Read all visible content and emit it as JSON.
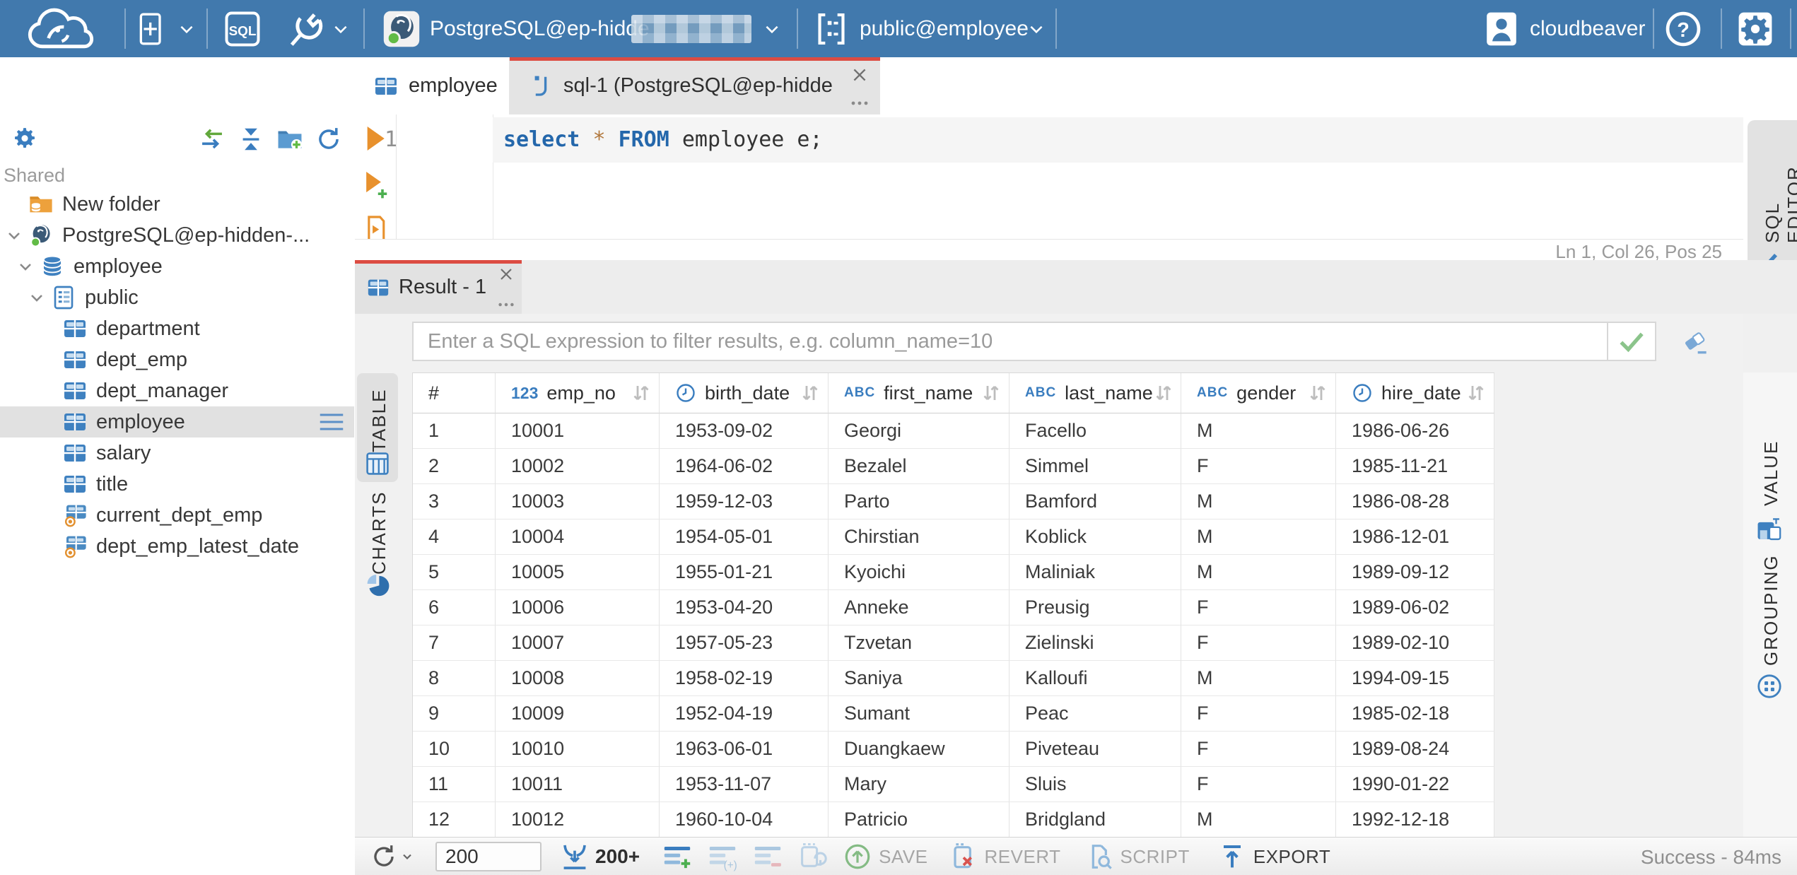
{
  "topbar": {
    "connection_label": "PostgreSQL@ep-hidde",
    "connection_redacted": true,
    "schema_label": "public@employee",
    "user_label": "cloudbeaver",
    "bg_color": "#4179ad"
  },
  "sidebar": {
    "section_label": "Shared",
    "items": [
      {
        "label": "New folder",
        "icon": "folder-db",
        "depth": 0,
        "expanded": false,
        "selected": false
      },
      {
        "label": "PostgreSQL@ep-hidden-...",
        "icon": "postgres",
        "depth": 0,
        "expanded": true,
        "selected": false
      },
      {
        "label": "employee",
        "icon": "database",
        "depth": 1,
        "expanded": true,
        "selected": false
      },
      {
        "label": "public",
        "icon": "schema",
        "depth": 2,
        "expanded": true,
        "selected": false
      },
      {
        "label": "department",
        "icon": "table",
        "depth": 3,
        "expanded": false,
        "selected": false
      },
      {
        "label": "dept_emp",
        "icon": "table",
        "depth": 3,
        "expanded": false,
        "selected": false
      },
      {
        "label": "dept_manager",
        "icon": "table",
        "depth": 3,
        "expanded": false,
        "selected": false
      },
      {
        "label": "employee",
        "icon": "table",
        "depth": 3,
        "expanded": false,
        "selected": true
      },
      {
        "label": "salary",
        "icon": "table",
        "depth": 3,
        "expanded": false,
        "selected": false
      },
      {
        "label": "title",
        "icon": "table",
        "depth": 3,
        "expanded": false,
        "selected": false
      },
      {
        "label": "current_dept_emp",
        "icon": "view",
        "depth": 3,
        "expanded": false,
        "selected": false
      },
      {
        "label": "dept_emp_latest_date",
        "icon": "view",
        "depth": 3,
        "expanded": false,
        "selected": false
      }
    ]
  },
  "tabs": {
    "items": [
      {
        "label": "employee",
        "active": false
      },
      {
        "label": "sql-1 (PostgreSQL@ep-hidde...",
        "active": true
      }
    ]
  },
  "editor": {
    "line_number": "1",
    "tokens": [
      {
        "text": "select",
        "type": "keyword"
      },
      {
        "text": " ",
        "type": "plain"
      },
      {
        "text": "*",
        "type": "star"
      },
      {
        "text": " ",
        "type": "plain"
      },
      {
        "text": "FROM",
        "type": "keyword"
      },
      {
        "text": " employee e;",
        "type": "plain"
      }
    ],
    "status": "Ln 1, Col 26, Pos 25",
    "sql_editor_tab_label": "SQL EDITOR"
  },
  "result": {
    "tab_label": "Result - 1",
    "filter_placeholder": "Enter a SQL expression to filter results, e.g. column_name=10",
    "left_tabs": [
      {
        "label": "TABLE",
        "icon": "grid-outline",
        "active": true
      },
      {
        "label": "CHARTS",
        "icon": "pie",
        "active": false
      }
    ],
    "right_tabs": [
      {
        "label": "VALUE",
        "icon": "value-panel"
      },
      {
        "label": "GROUPING",
        "icon": "grouping"
      }
    ]
  },
  "table": {
    "row_header": "#",
    "columns": [
      {
        "label": "emp_no",
        "type": "123"
      },
      {
        "label": "birth_date",
        "type": "clock"
      },
      {
        "label": "first_name",
        "type": "abc"
      },
      {
        "label": "last_name",
        "type": "abc"
      },
      {
        "label": "gender",
        "type": "abc"
      },
      {
        "label": "hire_date",
        "type": "clock"
      }
    ],
    "rows": [
      [
        "1",
        "10001",
        "1953-09-02",
        "Georgi",
        "Facello",
        "M",
        "1986-06-26"
      ],
      [
        "2",
        "10002",
        "1964-06-02",
        "Bezalel",
        "Simmel",
        "F",
        "1985-11-21"
      ],
      [
        "3",
        "10003",
        "1959-12-03",
        "Parto",
        "Bamford",
        "M",
        "1986-08-28"
      ],
      [
        "4",
        "10004",
        "1954-05-01",
        "Chirstian",
        "Koblick",
        "M",
        "1986-12-01"
      ],
      [
        "5",
        "10005",
        "1955-01-21",
        "Kyoichi",
        "Maliniak",
        "M",
        "1989-09-12"
      ],
      [
        "6",
        "10006",
        "1953-04-20",
        "Anneke",
        "Preusig",
        "F",
        "1989-06-02"
      ],
      [
        "7",
        "10007",
        "1957-05-23",
        "Tzvetan",
        "Zielinski",
        "F",
        "1989-02-10"
      ],
      [
        "8",
        "10008",
        "1958-02-19",
        "Saniya",
        "Kalloufi",
        "M",
        "1994-09-15"
      ],
      [
        "9",
        "10009",
        "1952-04-19",
        "Sumant",
        "Peac",
        "F",
        "1985-02-18"
      ],
      [
        "10",
        "10010",
        "1963-06-01",
        "Duangkaew",
        "Piveteau",
        "F",
        "1989-08-24"
      ],
      [
        "11",
        "10011",
        "1953-11-07",
        "Mary",
        "Sluis",
        "F",
        "1990-01-22"
      ],
      [
        "12",
        "10012",
        "1960-10-04",
        "Patricio",
        "Bridgland",
        "M",
        "1992-12-18"
      ]
    ]
  },
  "toolbar": {
    "row_limit_value": "200",
    "fetch_more_label": "200+",
    "save_label": "SAVE",
    "revert_label": "REVERT",
    "script_label": "SCRIPT",
    "export_label": "EXPORT",
    "status": "Success - 84ms"
  },
  "colors": {
    "topbar_blue": "#4179ad",
    "accent_red": "#dc4c42",
    "icon_blue": "#3a7dbf",
    "success_green": "#6db33f"
  }
}
